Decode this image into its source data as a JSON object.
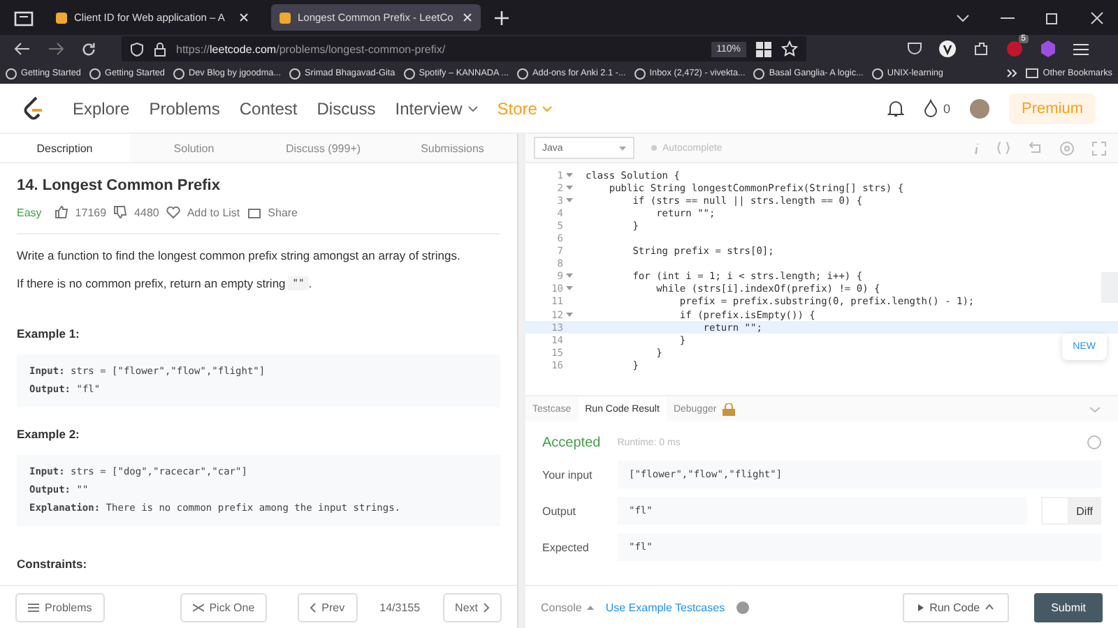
{
  "browser": {
    "tabs": [
      {
        "label": "Client ID for Web application – A",
        "selected": false
      },
      {
        "label": "Longest Common Prefix - LeetCo",
        "selected": true
      }
    ],
    "url": {
      "scheme": "https://",
      "host": "leetcode.com",
      "path": "/problems/longest-common-prefix/"
    },
    "zoom": "110%",
    "extension_badge": "5",
    "bookmarks": [
      "Getting Started",
      "Getting Started",
      "Dev Blog by jgoodma...",
      "Srimad Bhagavad-Gita",
      "Spotify – KANNADA ...",
      "Add-ons for Anki 2.1 -...",
      "Inbox (2,472) - vivekta...",
      "Basal Ganglia- A logic...",
      "UNIX-learning"
    ],
    "other_bookmarks": "Other Bookmarks"
  },
  "nav": {
    "items": [
      {
        "label": "Explore",
        "kind": "plain"
      },
      {
        "label": "Problems",
        "kind": "plain"
      },
      {
        "label": "Contest",
        "kind": "plain"
      },
      {
        "label": "Discuss",
        "kind": "plain"
      },
      {
        "label": "Interview",
        "kind": "menu"
      },
      {
        "label": "Store",
        "kind": "store"
      }
    ],
    "streak": "0",
    "premium": "Premium"
  },
  "panel_tabs": [
    {
      "label": "Description",
      "selected": true
    },
    {
      "label": "Solution",
      "selected": false
    },
    {
      "label": "Discuss (999+)",
      "selected": false
    },
    {
      "label": "Submissions",
      "selected": false
    }
  ],
  "problem": {
    "title": "14. Longest Common Prefix",
    "difficulty": "Easy",
    "likes": "17169",
    "dislikes": "4480",
    "add_to_list": "Add to List",
    "share": "Share",
    "paragraphs": [
      "Write a function to find the longest common prefix string amongst an array of strings.",
      "If there is no common prefix, return an empty string "
    ],
    "empty_string": "\"\"",
    "period": ".",
    "examples": [
      {
        "title": "Example 1:",
        "lines": [
          {
            "key": "Input:",
            "value": "strs = [\"flower\",\"flow\",\"flight\"]"
          },
          {
            "key": "Output:",
            "value": "\"fl\""
          }
        ]
      },
      {
        "title": "Example 2:",
        "lines": [
          {
            "key": "Input:",
            "value": "strs = [\"dog\",\"racecar\",\"car\"]"
          },
          {
            "key": "Output:",
            "value": "\"\""
          },
          {
            "key": "Explanation:",
            "value": "There is no common prefix among the input strings."
          }
        ]
      }
    ],
    "constraints_title": "Constraints:"
  },
  "left_footer": {
    "problems": "Problems",
    "pick_one": "Pick One",
    "prev": "Prev",
    "counter": "14/3155",
    "next": "Next"
  },
  "editor": {
    "language": "Java",
    "autocomplete": "Autocomplete",
    "lines": [
      {
        "number": "1",
        "foldable": true,
        "highlighted": false,
        "text": "class Solution {"
      },
      {
        "number": "2",
        "foldable": true,
        "highlighted": false,
        "text": "    public String longestCommonPrefix(String[] strs) {"
      },
      {
        "number": "3",
        "foldable": true,
        "highlighted": false,
        "text": "        if (strs == null || strs.length == 0) {"
      },
      {
        "number": "4",
        "foldable": false,
        "highlighted": false,
        "text": "            return \"\";"
      },
      {
        "number": "5",
        "foldable": false,
        "highlighted": false,
        "text": "        }"
      },
      {
        "number": "6",
        "foldable": false,
        "highlighted": false
      },
      {
        "number": "7",
        "foldable": false,
        "highlighted": false,
        "text": "        String prefix = strs[0];"
      },
      {
        "number": "8",
        "foldable": false,
        "highlighted": false
      },
      {
        "number": "9",
        "foldable": true,
        "highlighted": false,
        "text": "        for (int i = 1; i < strs.length; i++) {"
      },
      {
        "number": "10",
        "foldable": true,
        "highlighted": false,
        "text": "            while (strs[i].indexOf(prefix) != 0) {"
      },
      {
        "number": "11",
        "foldable": false,
        "highlighted": false,
        "text": "                prefix = prefix.substring(0, prefix.length() - 1);"
      },
      {
        "number": "12",
        "foldable": true,
        "highlighted": false,
        "text": "                if (prefix.isEmpty()) {"
      },
      {
        "number": "13",
        "foldable": false,
        "highlighted": true,
        "text": "                    return \"\";"
      },
      {
        "number": "14",
        "foldable": false,
        "highlighted": false,
        "text": "                }"
      },
      {
        "number": "15",
        "foldable": false,
        "highlighted": false,
        "text": "            }"
      },
      {
        "number": "16",
        "foldable": false,
        "highlighted": false,
        "text": "        }"
      }
    ],
    "new_badge": "NEW"
  },
  "result_tabs": [
    {
      "label": "Testcase",
      "selected": false
    },
    {
      "label": "Run Code Result",
      "selected": true
    },
    {
      "label": "Debugger",
      "selected": false
    }
  ],
  "result": {
    "status": "Accepted",
    "runtime": "Runtime: 0 ms",
    "rows": [
      {
        "label": "Your input",
        "value": "[\"flower\",\"flow\",\"flight\"]"
      },
      {
        "label": "Output",
        "value": "\"fl\""
      },
      {
        "label": "Expected",
        "value": "\"fl\""
      }
    ],
    "diff": "Diff"
  },
  "right_footer": {
    "console": "Console",
    "use_example": "Use Example Testcases",
    "run_code": "Run Code",
    "submit": "Submit"
  }
}
